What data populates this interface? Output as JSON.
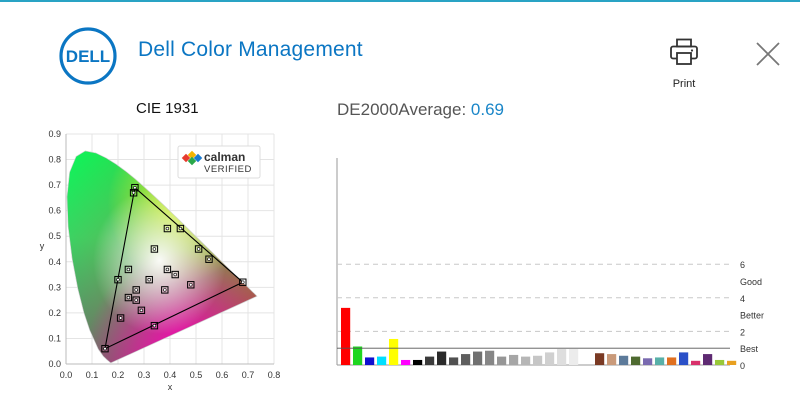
{
  "header": {
    "logo_text": "DELL",
    "title": "Dell Color Management",
    "print_label": "Print"
  },
  "cie": {
    "title": "CIE 1931",
    "xlabel": "x",
    "ylabel": "y",
    "badge_line1": "calman",
    "badge_line2": "VERIFIED"
  },
  "de": {
    "label": "DE2000Average: ",
    "value": "0.69",
    "value_color": "#1a86c8"
  },
  "chart_data": [
    {
      "type": "scatter",
      "title": "CIE 1931",
      "xlabel": "x",
      "ylabel": "y",
      "xlim": [
        0,
        0.8
      ],
      "ylim": [
        0,
        0.9
      ],
      "xticks": [
        "0.0",
        "0.1",
        "0.2",
        "0.3",
        "0.4",
        "0.5",
        "0.6",
        "0.7",
        "0.8"
      ],
      "yticks": [
        "0.0",
        "0.1",
        "0.2",
        "0.3",
        "0.4",
        "0.5",
        "0.6",
        "0.7",
        "0.8",
        "0.9"
      ],
      "grid": true,
      "gamut_triangle": [
        [
          0.68,
          0.32
        ],
        [
          0.265,
          0.69
        ],
        [
          0.15,
          0.06
        ]
      ],
      "target_points": [
        [
          0.265,
          0.69
        ],
        [
          0.15,
          0.06
        ],
        [
          0.68,
          0.32
        ],
        [
          0.26,
          0.67
        ],
        [
          0.39,
          0.53
        ],
        [
          0.44,
          0.53
        ],
        [
          0.34,
          0.45
        ],
        [
          0.51,
          0.45
        ],
        [
          0.55,
          0.41
        ],
        [
          0.39,
          0.37
        ],
        [
          0.42,
          0.35
        ],
        [
          0.32,
          0.33
        ],
        [
          0.48,
          0.31
        ],
        [
          0.38,
          0.29
        ],
        [
          0.24,
          0.37
        ],
        [
          0.2,
          0.33
        ],
        [
          0.27,
          0.29
        ],
        [
          0.24,
          0.26
        ],
        [
          0.27,
          0.25
        ],
        [
          0.29,
          0.21
        ],
        [
          0.21,
          0.18
        ],
        [
          0.34,
          0.15
        ]
      ]
    },
    {
      "type": "bar",
      "title": "",
      "xlabel": "",
      "ylabel": "",
      "ylim": [
        0,
        7
      ],
      "yticks": [
        0,
        2,
        4,
        6
      ],
      "zone_labels": [
        "Good",
        "Better",
        "Best"
      ],
      "grid": true,
      "values": [
        3.4,
        1.1,
        0.45,
        0.5,
        1.55,
        0.3,
        0.3,
        0.5,
        0.8,
        0.45,
        0.65,
        0.8,
        0.85,
        0.5,
        0.6,
        0.5,
        0.55,
        0.75,
        0.95,
        0.95,
        0.7,
        0.65,
        0.55,
        0.5,
        0.4,
        0.45,
        0.45,
        0.75,
        0.25,
        0.65,
        0.3,
        0.25
      ],
      "colors": [
        "#ff0000",
        "#1fd61f",
        "#1010d0",
        "#00e0ff",
        "#ffff00",
        "#ff00ff",
        "#000000",
        "#3a3a3a",
        "#2a2a2a",
        "#505050",
        "#5e5e5e",
        "#707070",
        "#868686",
        "#969696",
        "#a6a6a6",
        "#b6b6b6",
        "#c6c6c6",
        "#d0d0d0",
        "#dedede",
        "#ececec",
        "#7a3a24",
        "#c99a7a",
        "#5c7a9a",
        "#4e6a30",
        "#7a6ab0",
        "#58b0a8",
        "#e07020",
        "#2a50c8",
        "#d8306a",
        "#5e2a72",
        "#98c838",
        "#e8a020"
      ]
    }
  ]
}
